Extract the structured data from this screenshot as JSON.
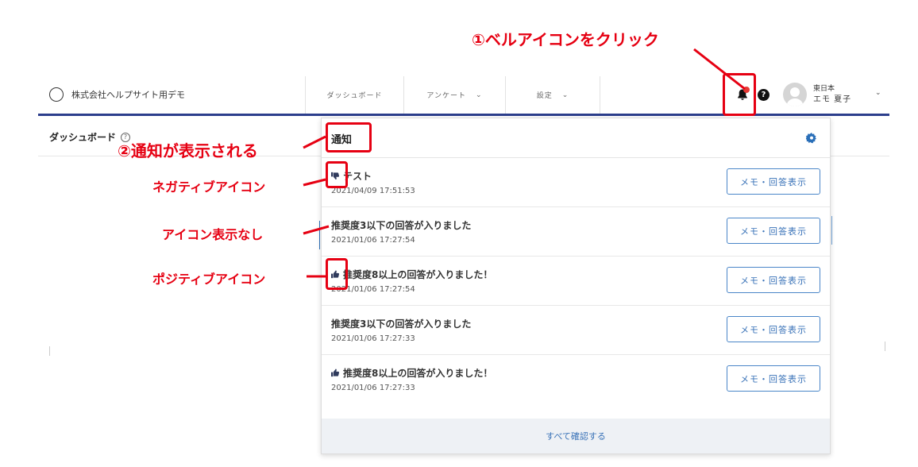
{
  "annotations": {
    "step1": "①ベルアイコンをクリック",
    "step2": "②通知が表示される",
    "negative": "ネガティブアイコン",
    "none": "アイコン表示なし",
    "positive": "ポジティブアイコン"
  },
  "navbar": {
    "company": "株式会社ヘルプサイト用デモ",
    "items": [
      {
        "label": "ダッシュボード"
      },
      {
        "label": "アンケート"
      },
      {
        "label": "設定"
      }
    ],
    "user": {
      "line1": "東日本",
      "line2": "エモ 夏子"
    }
  },
  "page": {
    "title": "ダッシュボード"
  },
  "panel": {
    "title": "通知",
    "notifications": [
      {
        "icon": "thumbs-down-icon",
        "title": "テスト",
        "date": "2021/04/09 17:51:53",
        "button": "メモ・回答表示"
      },
      {
        "icon": "",
        "title": "推奨度3以下の回答が入りました",
        "date": "2021/01/06 17:27:54",
        "button": "メモ・回答表示"
      },
      {
        "icon": "thumbs-up-icon",
        "title": "推奨度8以上の回答が入りました！",
        "date": "2021/01/06 17:27:54",
        "button": "メモ・回答表示"
      },
      {
        "icon": "",
        "title": "推奨度3以下の回答が入りました",
        "date": "2021/01/06 17:27:33",
        "button": "メモ・回答表示"
      },
      {
        "icon": "thumbs-up-icon",
        "title": "推奨度8以上の回答が入りました！",
        "date": "2021/01/06 17:27:33",
        "button": "メモ・回答表示"
      }
    ],
    "footer": "すべて確認する"
  },
  "colors": {
    "accent": "#2c3e8c",
    "annotation": "#e60012",
    "link": "#3a73b8",
    "bell_dot": "#e53935"
  }
}
